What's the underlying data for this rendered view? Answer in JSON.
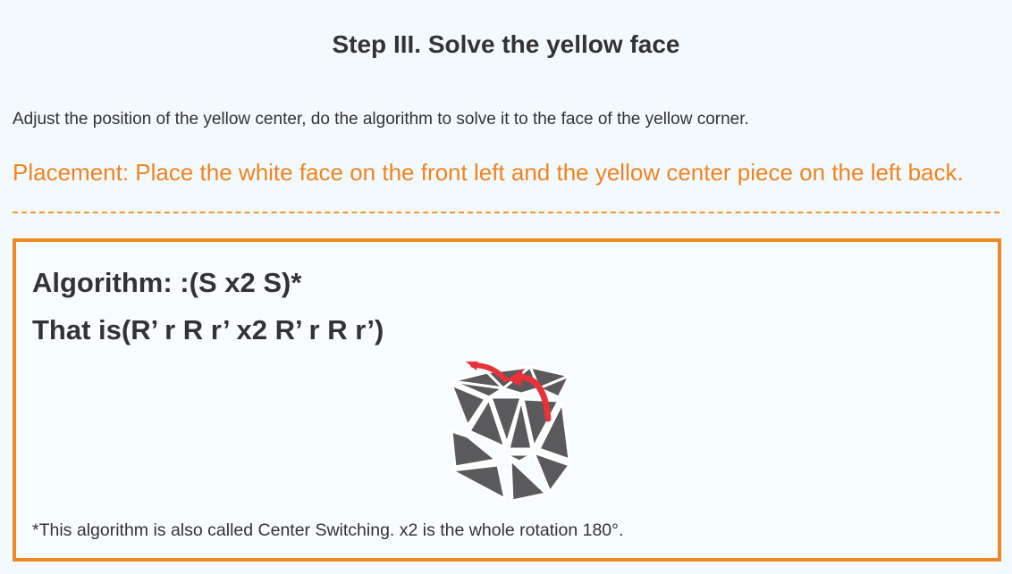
{
  "step": {
    "title": "Step III. Solve the yellow face"
  },
  "intro": {
    "text": "Adjust the position of the yellow center, do the algorithm to solve it to the face of the yellow corner."
  },
  "placement": {
    "text": "Placement: Place the white face on the front left and the yellow center piece on the left back."
  },
  "algorithm": {
    "line1": "Algorithm: :(S x2 S)*",
    "line2": "That is(R’ r R r’ x2 R’ r R r’)",
    "note": "*This algorithm is also called Center Switching. x2 is the whole rotation 180°."
  },
  "colors": {
    "accent": "#f0831e",
    "box_border": "#f0871e",
    "cube_grey": "#5a5a5c",
    "arrow_red": "#e8323a",
    "background": "#f3faff"
  },
  "icons": {
    "cube": "skewb-cube-icon",
    "arrow": "rotation-arrow-icon"
  }
}
